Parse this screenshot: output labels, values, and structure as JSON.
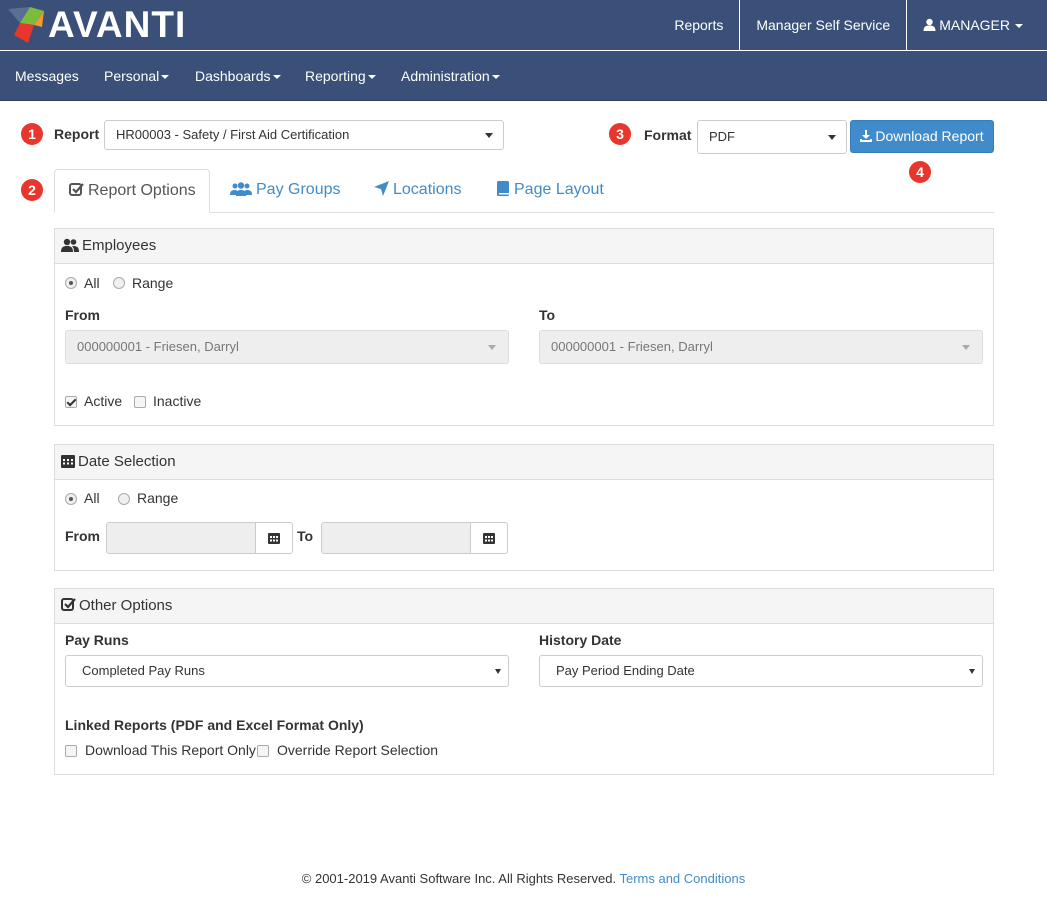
{
  "app": {
    "logo_text": "AVANTI"
  },
  "topnav": {
    "reports": "Reports",
    "manager_self_service": "Manager Self Service",
    "user": "MANAGER"
  },
  "nav": {
    "items": [
      "Messages",
      "Personal",
      "Dashboards",
      "Reporting",
      "Administration"
    ]
  },
  "steps": [
    "1",
    "2",
    "3",
    "4"
  ],
  "report": {
    "label": "Report",
    "selected": "HR00003 - Safety / First Aid Certification"
  },
  "format": {
    "label": "Format",
    "selected": "PDF"
  },
  "download_button": "Download Report",
  "tabs": [
    "Report Options",
    "Pay Groups",
    "Locations",
    "Page Layout"
  ],
  "employees": {
    "title": "Employees",
    "radio_all": "All",
    "radio_range": "Range",
    "selected_radio": "All",
    "from_label": "From",
    "to_label": "To",
    "from_value": "000000001 - Friesen, Darryl",
    "to_value": "000000001 - Friesen, Darryl",
    "active_label": "Active",
    "active_checked": true,
    "inactive_label": "Inactive",
    "inactive_checked": false
  },
  "date_selection": {
    "title": "Date Selection",
    "radio_all": "All",
    "radio_range": "Range",
    "selected_radio": "All",
    "from_label": "From",
    "to_label": "To"
  },
  "other_options": {
    "title": "Other Options",
    "pay_runs_label": "Pay Runs",
    "pay_runs_value": "Completed Pay Runs",
    "history_date_label": "History Date",
    "history_date_value": "Pay Period Ending Date",
    "linked_reports_label": "Linked Reports (PDF and Excel Format Only)",
    "download_only_label": "Download This Report Only",
    "override_label": "Override Report Selection"
  },
  "footer": {
    "copyright": "© 2001-2019 Avanti Software Inc. All Rights Reserved.",
    "terms_link": "Terms and Conditions"
  },
  "colors": {
    "header_bg": "#3a5078",
    "badge_red": "#e8362c",
    "link_blue": "#428bca"
  },
  "icons": [
    "avanti-logo-icon",
    "user-icon",
    "download-icon",
    "checkbox-icon",
    "users-icon",
    "location-arrow-icon",
    "book-icon",
    "calendar-icon"
  ]
}
